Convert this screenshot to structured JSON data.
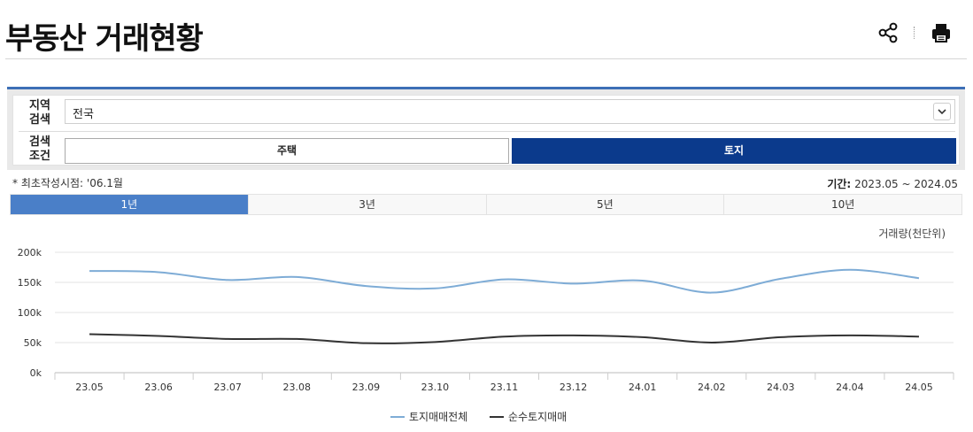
{
  "page": {
    "title": "부동산 거래현황"
  },
  "toolbar": {
    "share_icon": "share-icon",
    "print_icon": "print-icon"
  },
  "filters": {
    "region_label": "지역\n검색",
    "region_value": "전국",
    "condition_label": "검색\n조건",
    "conditions": [
      "주택",
      "토지"
    ],
    "selected_condition": "토지"
  },
  "info": {
    "first_date": "* 최초작성시점: '06.1월",
    "period_label": "기간:",
    "period_value": "2023.05 ~ 2024.05"
  },
  "tabs": [
    "1년",
    "3년",
    "5년",
    "10년"
  ],
  "active_tab": "1년",
  "colors": {
    "accent": "#0b3a8c",
    "tab_active": "#4a7fc8",
    "series_total": "#7eacd6",
    "series_pure": "#333333"
  },
  "chart_data": {
    "type": "line",
    "unit": "거래량(천단위)",
    "categories": [
      "23.05",
      "23.06",
      "23.07",
      "23.08",
      "23.09",
      "23.10",
      "23.11",
      "23.12",
      "24.01",
      "24.02",
      "24.03",
      "24.04",
      "24.05"
    ],
    "yticks": [
      "0k",
      "50k",
      "100k",
      "150k",
      "200k"
    ],
    "ylim": [
      0,
      200
    ],
    "series": [
      {
        "name": "토지매매전체",
        "values": [
          169,
          167,
          154,
          159,
          144,
          140,
          155,
          148,
          153,
          133,
          156,
          171,
          157
        ]
      },
      {
        "name": "순수토지매매",
        "values": [
          64,
          61,
          56,
          56,
          49,
          51,
          60,
          62,
          59,
          50,
          59,
          62,
          60
        ]
      }
    ],
    "grid": true,
    "legend": "bottom"
  }
}
